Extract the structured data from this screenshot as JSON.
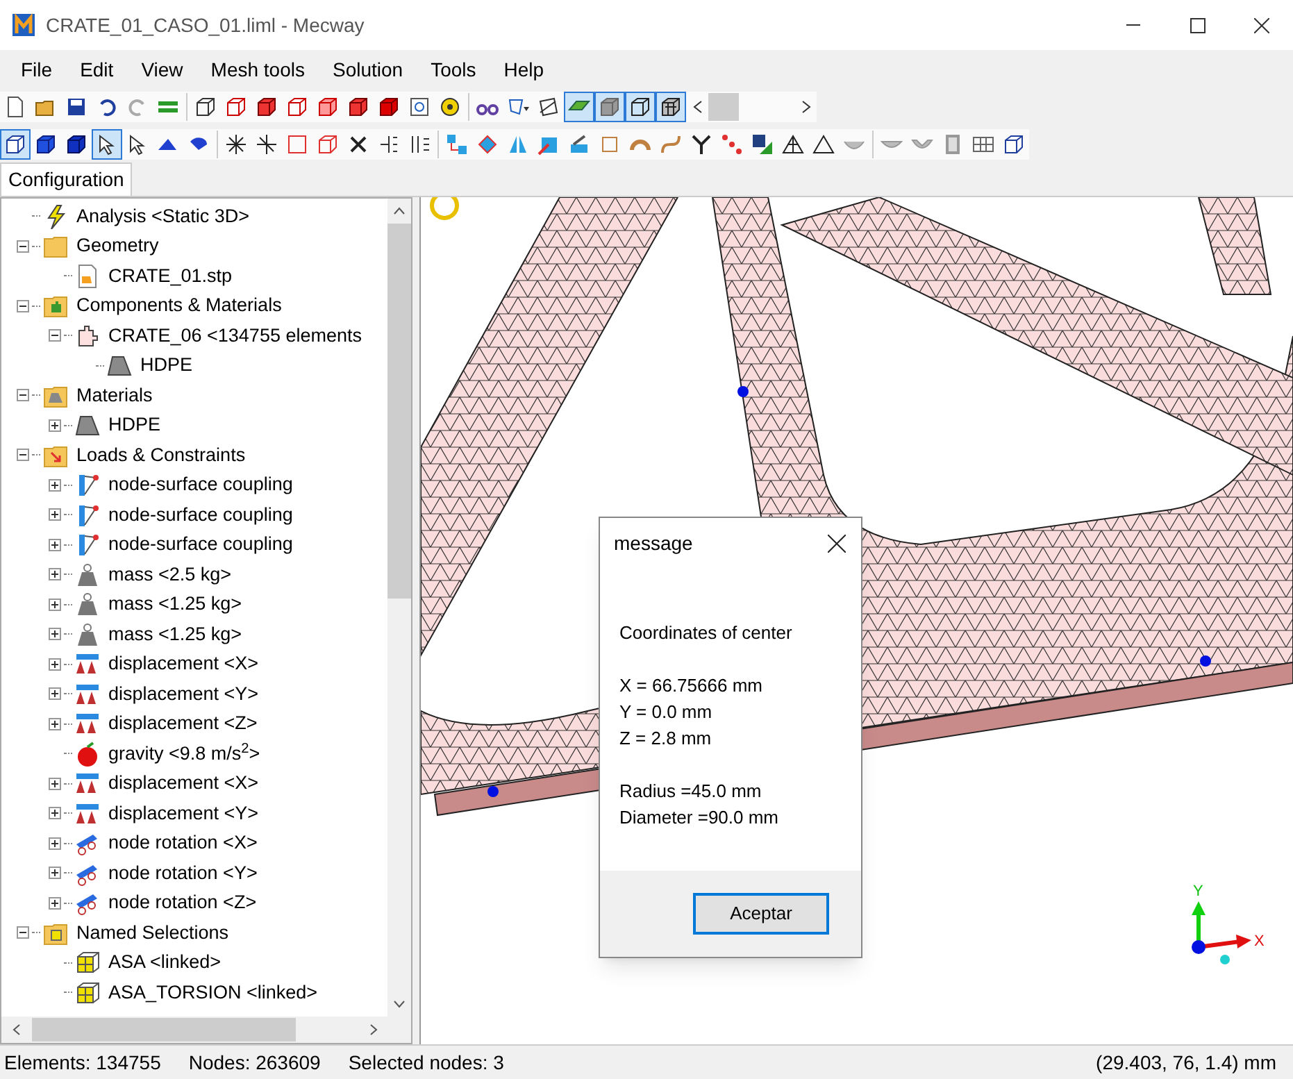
{
  "window": {
    "title": "CRATE_01_CASO_01.liml - Mecway"
  },
  "menu": [
    "File",
    "Edit",
    "View",
    "Mesh tools",
    "Solution",
    "Tools",
    "Help"
  ],
  "toolbar_1": [
    {
      "pressed": false
    },
    {
      "pressed": false
    },
    {
      "pressed": false
    },
    {
      "pressed": false
    },
    {
      "pressed": false
    },
    {
      "pressed": false
    },
    {
      "pressed": false
    },
    {
      "pressed": false
    },
    {
      "pressed": false
    },
    {
      "pressed": false
    },
    {
      "pressed": false
    },
    {
      "pressed": false
    },
    {
      "pressed": false
    },
    {
      "pressed": false
    },
    {
      "pressed": false
    },
    {
      "pressed": false
    },
    {
      "pressed": false
    },
    {
      "pressed": false
    },
    {
      "pressed": true
    },
    {
      "pressed": true
    },
    {
      "pressed": true
    },
    {
      "pressed": true
    }
  ],
  "toolbar_2": [
    {
      "pressed": true
    },
    {
      "pressed": false
    },
    {
      "pressed": false
    },
    {
      "pressed": true
    },
    {
      "pressed": false
    },
    {
      "pressed": false
    },
    {
      "pressed": false
    },
    {
      "pressed": false
    },
    {
      "pressed": false
    },
    {
      "pressed": false
    },
    {
      "pressed": false
    },
    {
      "pressed": false
    },
    {
      "pressed": false
    },
    {
      "pressed": false
    },
    {
      "pressed": false
    },
    {
      "pressed": false
    },
    {
      "pressed": false
    },
    {
      "pressed": false
    },
    {
      "pressed": false
    },
    {
      "pressed": false
    },
    {
      "pressed": false
    },
    {
      "pressed": false
    },
    {
      "pressed": false
    },
    {
      "pressed": false
    },
    {
      "pressed": false
    },
    {
      "pressed": false
    },
    {
      "pressed": false
    },
    {
      "pressed": false
    },
    {
      "pressed": false
    },
    {
      "pressed": false
    },
    {
      "pressed": false
    },
    {
      "pressed": false
    },
    {
      "pressed": false
    }
  ],
  "tabs": [
    {
      "label": "Configuration",
      "selected": true
    }
  ],
  "tree": [
    {
      "label": "Analysis <Static 3D>",
      "kind": "analysis"
    },
    {
      "label": "Geometry",
      "kind": "folder",
      "expanded": true,
      "children": [
        {
          "label": "CRATE_01.stp",
          "kind": "file"
        }
      ]
    },
    {
      "label": "Components & Materials",
      "kind": "components",
      "expanded": true,
      "children": [
        {
          "label": "CRATE_06 <134755 elements",
          "kind": "component",
          "expanded": true,
          "children": [
            {
              "label": "HDPE",
              "kind": "material"
            }
          ]
        }
      ]
    },
    {
      "label": "Materials",
      "kind": "materials",
      "expanded": true,
      "children": [
        {
          "label": "HDPE",
          "kind": "material",
          "expanded": false
        }
      ]
    },
    {
      "label": "Loads & Constraints",
      "kind": "loads",
      "expanded": true,
      "children": [
        {
          "label": "node-surface coupling",
          "kind": "coupling",
          "expanded": false
        },
        {
          "label": "node-surface coupling",
          "kind": "coupling",
          "expanded": false
        },
        {
          "label": "node-surface coupling",
          "kind": "coupling",
          "expanded": false
        },
        {
          "label": "mass <2.5 kg>",
          "kind": "mass",
          "expanded": false
        },
        {
          "label": "mass <1.25 kg>",
          "kind": "mass",
          "expanded": false
        },
        {
          "label": "mass <1.25 kg>",
          "kind": "mass",
          "expanded": false
        },
        {
          "label": "displacement <X>",
          "kind": "displacement",
          "expanded": false
        },
        {
          "label": "displacement <Y>",
          "kind": "displacement",
          "expanded": false
        },
        {
          "label": "displacement <Z>",
          "kind": "displacement",
          "expanded": false
        },
        {
          "label": "gravity <9.8 m/s$^{2}$>",
          "kind": "gravity"
        },
        {
          "label": "displacement <X>",
          "kind": "displacement",
          "expanded": false
        },
        {
          "label": "displacement <Y>",
          "kind": "displacement",
          "expanded": false
        },
        {
          "label": "node rotation <X>",
          "kind": "rotation",
          "expanded": false
        },
        {
          "label": "node rotation <Y>",
          "kind": "rotation",
          "expanded": false
        },
        {
          "label": "node rotation <Z>",
          "kind": "rotation",
          "expanded": false
        }
      ]
    },
    {
      "label": "Named Selections",
      "kind": "selections",
      "expanded": true,
      "children": [
        {
          "label": "ASA <linked>",
          "kind": "selection"
        },
        {
          "label": "ASA_TORSION <linked>",
          "kind": "selection"
        }
      ]
    }
  ],
  "axes": {
    "x": "X",
    "y": "Y"
  },
  "dialog": {
    "title": "message",
    "paragraphs": [
      [
        "Coordinates of center"
      ],
      [
        "X = 66.75666 mm",
        "Y = 0.0 mm",
        "Z = 2.8 mm"
      ],
      [
        "Radius =45.0 mm",
        "Diameter =90.0 mm"
      ]
    ],
    "button": {
      "label": "Aceptar",
      "focused": true
    }
  },
  "status_bar": {
    "elements": "Elements: 134755",
    "nodes": "Nodes: 263609",
    "selected": "Selected nodes: 3",
    "coordinates": "(29.403, 76, 1.4) mm"
  }
}
